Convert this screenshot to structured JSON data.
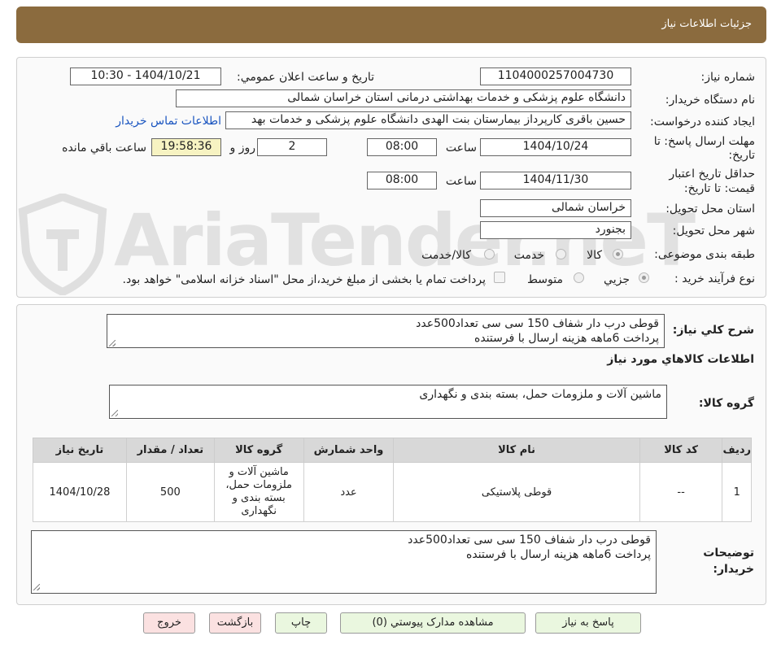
{
  "header": {
    "title": "جزئیات اطلاعات نیاز"
  },
  "form": {
    "need_number_label": "شماره نیاز:",
    "need_number": "1104000257004730",
    "announce_label": "تاریخ و ساعت اعلان عمومي:",
    "announce_value": "1404/10/21 - 10:30",
    "buyer_org_label": "نام دستگاه خریدار:",
    "buyer_org": "دانشگاه علوم پزشکی و خدمات بهداشتی درمانی استان خراسان شمالی",
    "requester_label": "ایجاد کننده درخواست:",
    "requester": "حسین باقری کارپرداز بیمارستان بنت الهدی دانشگاه علوم پزشکی و خدمات بهد",
    "contact_link": "اطلاعات تماس خریدار",
    "deadline_label_1": "مهلت ارسال پاسخ: تا",
    "deadline_label_2": "تاریخ:",
    "deadline_date": "1404/10/24",
    "time_label": "ساعت",
    "deadline_time": "08:00",
    "days_value": "2",
    "days_label": "روز و",
    "remaining_time": "19:58:36",
    "remaining_label": "ساعت باقي مانده",
    "validity_label_1": "حداقل تاریخ اعتبار",
    "validity_label_2": "قیمت: تا تاریخ:",
    "validity_date": "1404/11/30",
    "validity_time": "08:00",
    "province_label": "استان محل تحویل:",
    "province": "خراسان شمالی",
    "city_label": "شهر محل تحویل:",
    "city": "بجنورد",
    "category_label": "طبقه بندی موضوعی:",
    "category_options": [
      "کالا",
      "خدمت",
      "کالا/خدمت"
    ],
    "purchase_type_label": "نوع فرآیند خرید :",
    "purchase_options": [
      "جزیي",
      "متوسط"
    ],
    "payment_note": "پرداخت تمام یا بخشی از مبلغ خرید،از محل \"اسناد خزانه اسلامی\" خواهد بود."
  },
  "details": {
    "summary_label": "شرح کلي نیاز:",
    "summary_text": "قوطی درب دار شفاف  150 سی سی تعداد500عدد\nپرداخت 6ماهه هزینه ارسال با فرستنده",
    "goods_info_title": "اطلاعات کالاهاي مورد نیاز",
    "goods_group_label": "گروه کالا:",
    "goods_group_text": "ماشین آلات و ملزومات حمل، بسته بندی و نگهداری",
    "table": {
      "headers": [
        "ردیف",
        "کد کالا",
        "نام کالا",
        "واحد شمارش",
        "گروه کالا",
        "تعداد / مقدار",
        "تاریخ نیاز"
      ],
      "rows": [
        [
          "1",
          "--",
          "قوطی پلاستیکی",
          "عدد",
          "ماشین آلات و ملزومات حمل، بسته بندی و نگهداری",
          "500",
          "1404/10/28"
        ]
      ]
    },
    "buyer_notes_label_1": "توضیحات",
    "buyer_notes_label_2": "خریدار:",
    "buyer_notes_text": "قوطی درب دار شفاف  150 سی سی تعداد500عدد\nپرداخت 6ماهه هزینه ارسال با فرستنده"
  },
  "buttons": {
    "reply": "پاسخ به نیاز",
    "attachments": "مشاهده مدارک پیوستي (0)",
    "print": "چاپ",
    "back": "بازگشت",
    "exit": "خروج"
  },
  "watermark": {
    "text": "AriaTender.neT"
  }
}
